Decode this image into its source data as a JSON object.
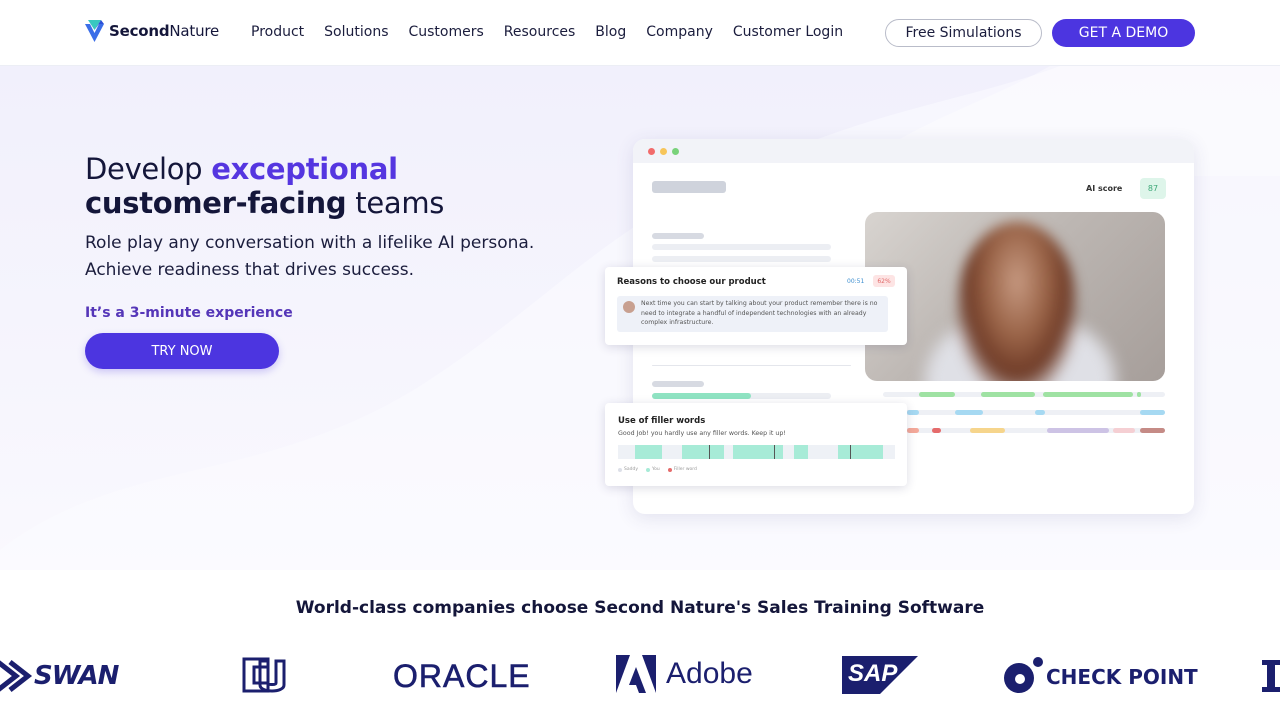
{
  "brand": {
    "name_bold": "Second",
    "name_light": "Nature",
    "accent": "#4c35e0",
    "mark_icon": "secondnature-logo-icon"
  },
  "nav": {
    "links": [
      "Product",
      "Solutions",
      "Customers",
      "Resources",
      "Blog",
      "Company",
      "Customer Login"
    ],
    "cta_outline": "Free Simulations",
    "cta_primary": "GET A DEMO"
  },
  "hero": {
    "title_part1": "Develop ",
    "title_accent": "exceptional",
    "title_bold": "customer-facing",
    "title_part2": " teams",
    "subtitle": "Role play any conversation with a lifelike AI persona. Achieve readiness that drives success.",
    "note": "It’s a 3-minute experience",
    "cta": "TRY NOW"
  },
  "mockup": {
    "ai_score_label": "AI score",
    "ai_score_value": "87",
    "card1": {
      "title": "Reasons to choose our product",
      "time": "00:51",
      "percent": "62%",
      "body": "Next time you can start by talking about your product remember there is no need to integrate a handful of independent technologies with an already complex infrastructure."
    },
    "card2": {
      "title": "Use of filler words",
      "subtitle": "Good Job! you hardly use any filler words. Keep it up!",
      "legend": [
        "Saddy",
        "You",
        "Filler word"
      ]
    }
  },
  "trust": {
    "headline": "World-class companies choose Second Nature's Sales Training Software",
    "logos": [
      "SWAN",
      "CU",
      "ORACLE",
      "Adobe",
      "SAP",
      "CHECK POINT"
    ]
  }
}
